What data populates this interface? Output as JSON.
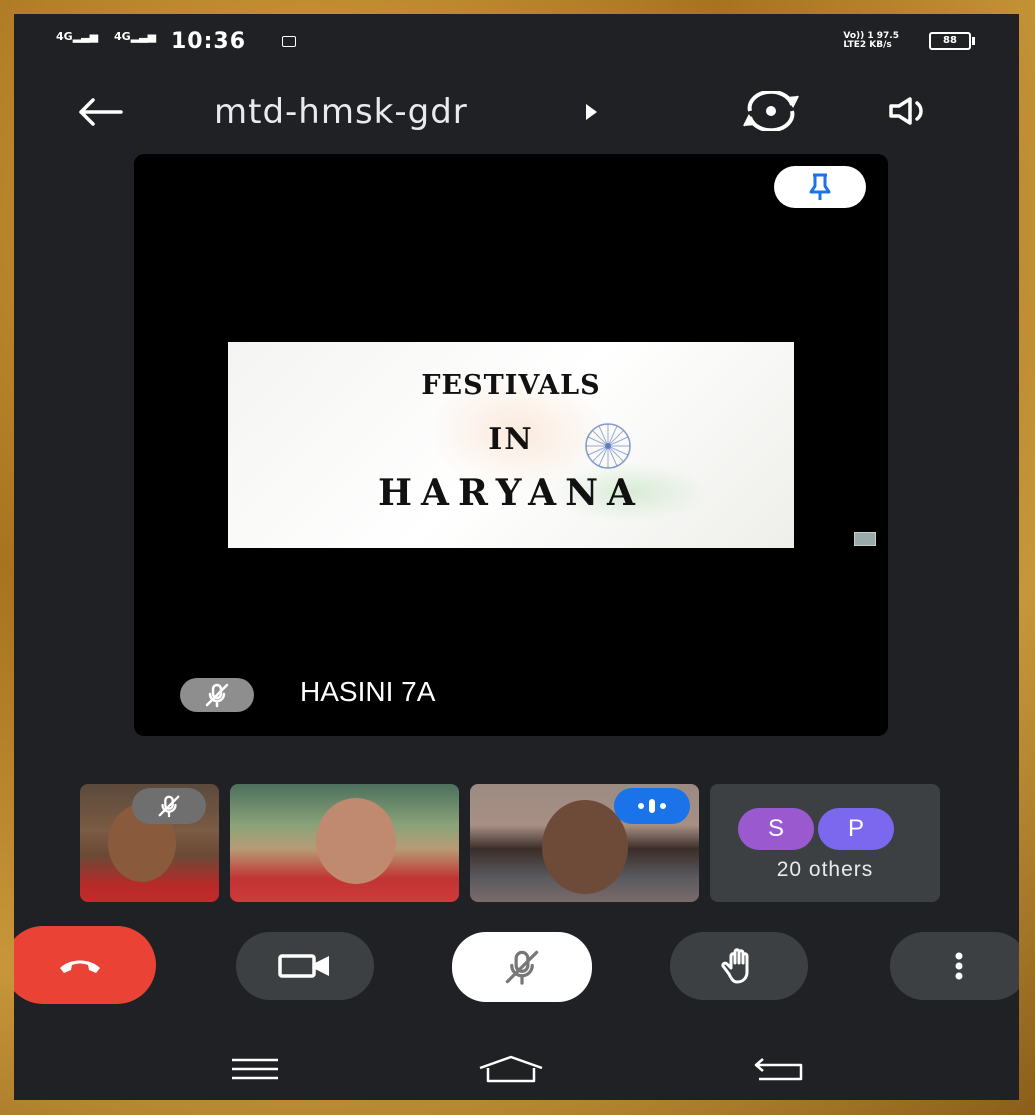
{
  "status_bar": {
    "signal_1": "4G",
    "signal_2": "4G",
    "time": "10:36",
    "net_label_1": "Vo)) 1",
    "net_label_2": "LTE2",
    "speed_value": "97.5",
    "speed_unit": "KB/s",
    "battery": "88"
  },
  "app_bar": {
    "meeting_code": "mtd-hmsk-gdr"
  },
  "main_tile": {
    "presenter_name": "HASINI 7A",
    "slide": {
      "line1": "FESTIVALS",
      "line2": "IN",
      "line3": "HARYANA"
    }
  },
  "participants": {
    "avatar_s": "S",
    "avatar_p": "P",
    "others_label": "20 others"
  },
  "colors": {
    "end_call": "#ea4335",
    "accent_blue": "#1a73e8",
    "background": "#202124",
    "control_bg": "#3c4043"
  },
  "icons": {
    "back": "arrow-left-icon",
    "switch_camera": "switch-camera-icon",
    "speaker": "speaker-icon",
    "pin": "pin-icon",
    "mic_off": "mic-off-icon",
    "end_call": "phone-hangup-icon",
    "camera": "videocam-icon",
    "raise_hand": "hand-icon",
    "more": "more-vert-icon"
  }
}
